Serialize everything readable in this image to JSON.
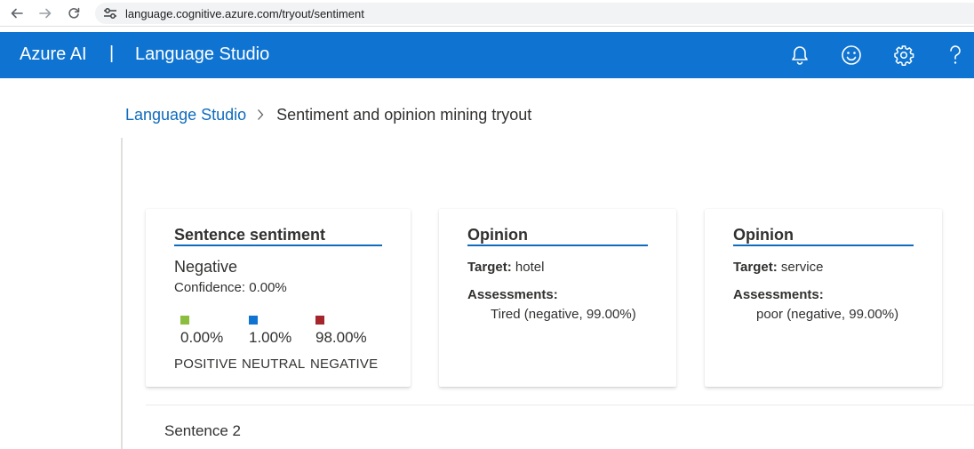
{
  "browser": {
    "url": "language.cognitive.azure.com/tryout/sentiment"
  },
  "header": {
    "brand": "Azure AI",
    "separator": "|",
    "product": "Language Studio"
  },
  "breadcrumb": {
    "root": "Language Studio",
    "current": "Sentiment and opinion mining tryout"
  },
  "sentence_card": {
    "title": "Sentence sentiment",
    "sentiment": "Negative",
    "confidence": "Confidence: 0.00%",
    "scores": [
      {
        "percent": "0.00%",
        "label": "POSITIVE",
        "color": "#8cbd3f"
      },
      {
        "percent": "1.00%",
        "label": "NEUTRAL",
        "color": "#0f74d1"
      },
      {
        "percent": "98.00%",
        "label": "NEGATIVE",
        "color": "#a4262c"
      }
    ]
  },
  "opinions": [
    {
      "title": "Opinion",
      "target_label": "Target:",
      "target_value": "hotel",
      "assessments_label": "Assessments:",
      "assessment": "Tired (negative, 99.00%)"
    },
    {
      "title": "Opinion",
      "target_label": "Target:",
      "target_value": "service",
      "assessments_label": "Assessments:",
      "assessment": "poor (negative, 99.00%)"
    }
  ],
  "next_section": "Sentence 2",
  "colors": {
    "header_bg": "#0f74d1",
    "link": "#0f6cbd",
    "underline": "#0f6cbd"
  }
}
